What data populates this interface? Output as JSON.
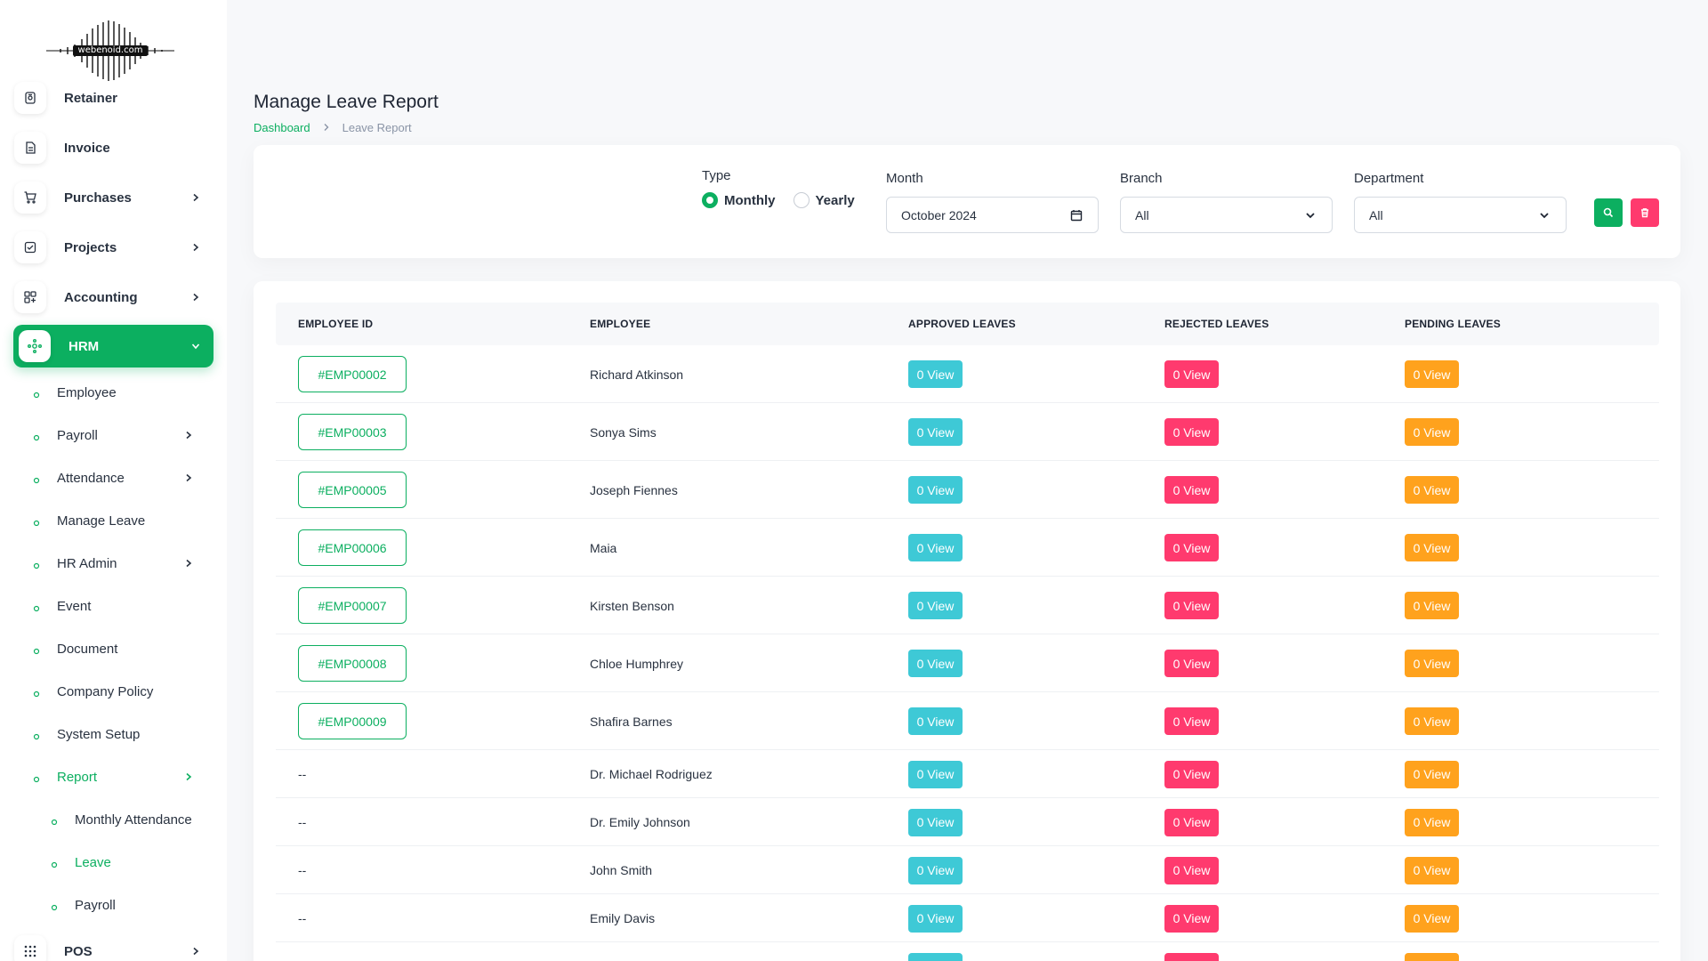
{
  "brand": {
    "logo_text": "webenoid.com"
  },
  "sidebar": {
    "items": [
      {
        "label": "Retainer",
        "icon": "retainer-icon",
        "has_chevron": false
      },
      {
        "label": "Invoice",
        "icon": "invoice-icon",
        "has_chevron": false
      },
      {
        "label": "Purchases",
        "icon": "cart-icon",
        "has_chevron": true
      },
      {
        "label": "Projects",
        "icon": "checklist-icon",
        "has_chevron": true
      },
      {
        "label": "Accounting",
        "icon": "grid-icon",
        "has_chevron": true
      },
      {
        "label": "HRM",
        "icon": "hrm-icon",
        "has_chevron": true,
        "active": true
      }
    ],
    "hrm_sub": [
      {
        "label": "Employee",
        "has_chevron": false
      },
      {
        "label": "Payroll",
        "has_chevron": true
      },
      {
        "label": "Attendance",
        "has_chevron": true
      },
      {
        "label": "Manage Leave",
        "has_chevron": false
      },
      {
        "label": "HR Admin",
        "has_chevron": true
      },
      {
        "label": "Event",
        "has_chevron": false
      },
      {
        "label": "Document",
        "has_chevron": false
      },
      {
        "label": "Company Policy",
        "has_chevron": false
      },
      {
        "label": "System Setup",
        "has_chevron": false
      },
      {
        "label": "Report",
        "has_chevron": true,
        "active": true
      }
    ],
    "report_sub": [
      {
        "label": "Monthly Attendance",
        "active": false
      },
      {
        "label": "Leave",
        "active": true
      },
      {
        "label": "Payroll",
        "active": false
      }
    ],
    "bottom_item": {
      "label": "POS",
      "icon": "apps-grid-icon",
      "has_chevron": true
    }
  },
  "header": {
    "title": "Manage Leave Report",
    "breadcrumb": {
      "home": "Dashboard",
      "current": "Leave Report"
    }
  },
  "filters": {
    "type_label": "Type",
    "type_options": [
      {
        "label": "Monthly",
        "checked": true
      },
      {
        "label": "Yearly",
        "checked": false
      }
    ],
    "month_label": "Month",
    "month_value": "October 2024",
    "branch_label": "Branch",
    "branch_value": "All",
    "department_label": "Department",
    "department_value": "All"
  },
  "table": {
    "columns": [
      "EMPLOYEE ID",
      "EMPLOYEE",
      "APPROVED LEAVES",
      "REJECTED LEAVES",
      "PENDING LEAVES"
    ],
    "rows": [
      {
        "id": "#EMP00002",
        "name": "Richard Atkinson",
        "approved": "0 View",
        "rejected": "0 View",
        "pending": "0 View"
      },
      {
        "id": "#EMP00003",
        "name": "Sonya Sims",
        "approved": "0 View",
        "rejected": "0 View",
        "pending": "0 View"
      },
      {
        "id": "#EMP00005",
        "name": "Joseph Fiennes",
        "approved": "0 View",
        "rejected": "0 View",
        "pending": "0 View"
      },
      {
        "id": "#EMP00006",
        "name": "Maia",
        "approved": "0 View",
        "rejected": "0 View",
        "pending": "0 View"
      },
      {
        "id": "#EMP00007",
        "name": "Kirsten Benson",
        "approved": "0 View",
        "rejected": "0 View",
        "pending": "0 View"
      },
      {
        "id": "#EMP00008",
        "name": "Chloe Humphrey",
        "approved": "0 View",
        "rejected": "0 View",
        "pending": "0 View"
      },
      {
        "id": "#EMP00009",
        "name": "Shafira Barnes",
        "approved": "0 View",
        "rejected": "0 View",
        "pending": "0 View"
      },
      {
        "id": "--",
        "name": "Dr. Michael Rodriguez",
        "approved": "0 View",
        "rejected": "0 View",
        "pending": "0 View"
      },
      {
        "id": "--",
        "name": "Dr. Emily Johnson",
        "approved": "0 View",
        "rejected": "0 View",
        "pending": "0 View"
      },
      {
        "id": "--",
        "name": "John Smith",
        "approved": "0 View",
        "rejected": "0 View",
        "pending": "0 View"
      },
      {
        "id": "--",
        "name": "Emily Davis",
        "approved": "0 View",
        "rejected": "0 View",
        "pending": "0 View"
      },
      {
        "id": "",
        "name": "",
        "approved": "",
        "rejected": "",
        "pending": ""
      }
    ]
  },
  "colors": {
    "primary": "#0caf60",
    "approved": "#3ec9d6",
    "rejected": "#ff3a6e",
    "pending": "#ffa21d"
  }
}
